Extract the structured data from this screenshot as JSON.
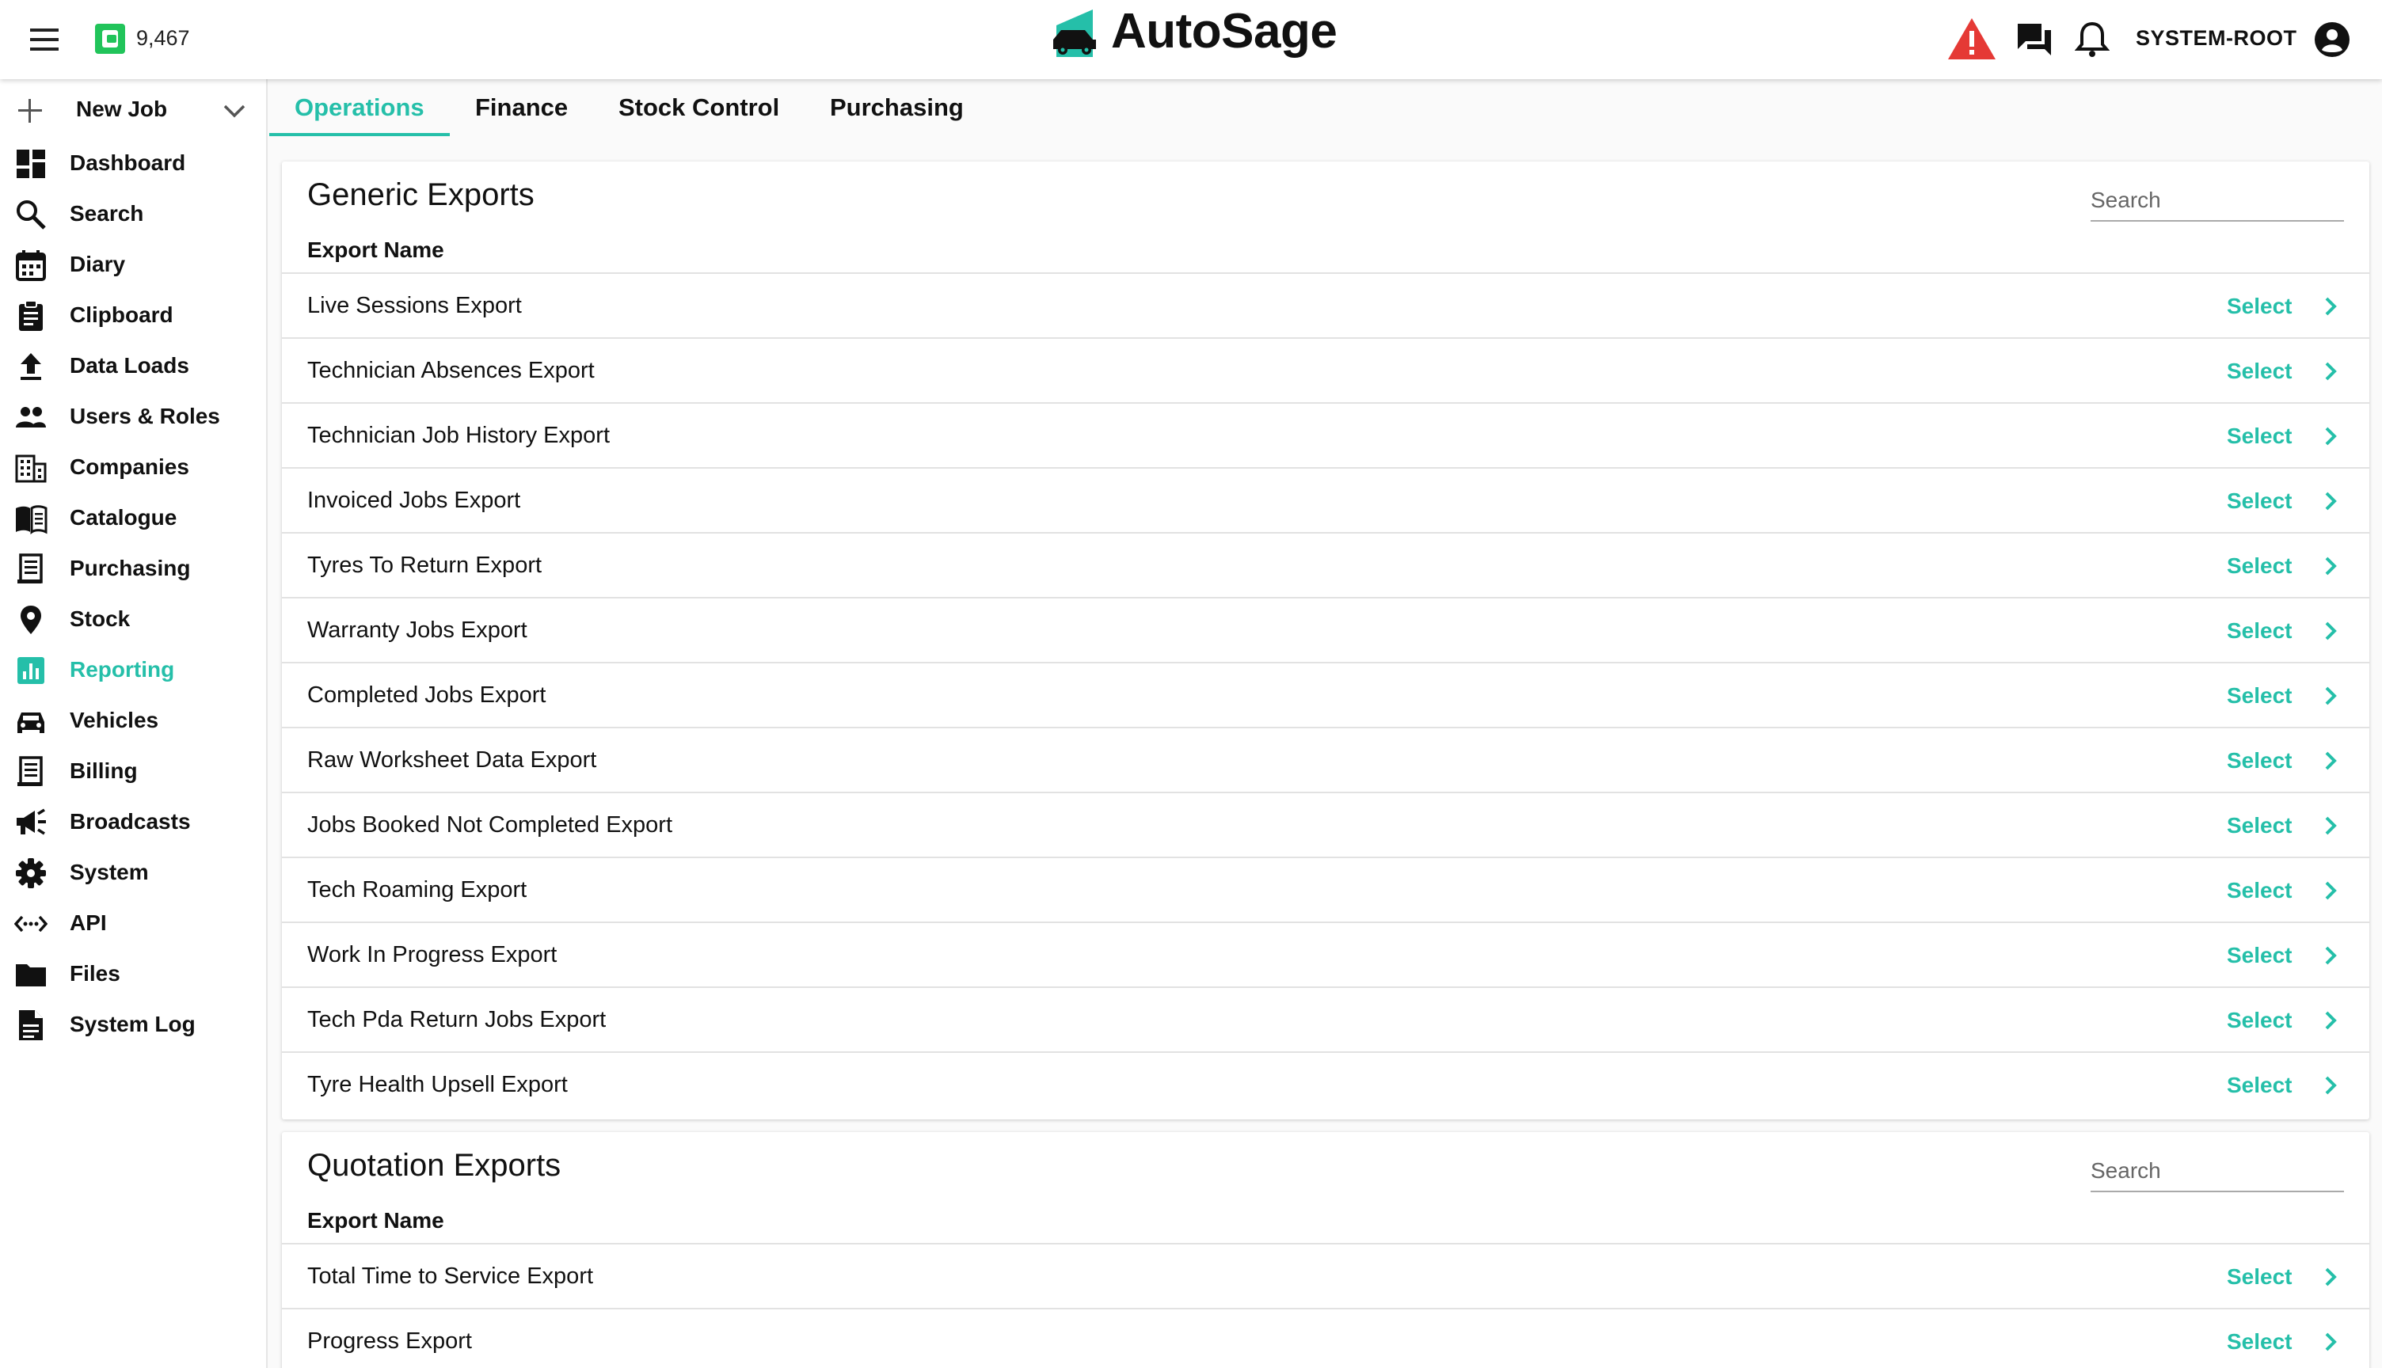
{
  "header": {
    "credit_value": "9,467",
    "brand_name": "AutoSage",
    "username": "SYSTEM-ROOT"
  },
  "sidebar": {
    "new_job_label": "New Job",
    "items": [
      {
        "label": "Dashboard",
        "icon": "dashboard-icon"
      },
      {
        "label": "Search",
        "icon": "search-icon"
      },
      {
        "label": "Diary",
        "icon": "calendar-icon"
      },
      {
        "label": "Clipboard",
        "icon": "clipboard-icon"
      },
      {
        "label": "Data Loads",
        "icon": "upload-icon"
      },
      {
        "label": "Users & Roles",
        "icon": "users-icon"
      },
      {
        "label": "Companies",
        "icon": "building-icon"
      },
      {
        "label": "Catalogue",
        "icon": "book-icon"
      },
      {
        "label": "Purchasing",
        "icon": "receipt-icon"
      },
      {
        "label": "Stock",
        "icon": "location-pin-icon"
      },
      {
        "label": "Reporting",
        "icon": "chart-icon",
        "active": true
      },
      {
        "label": "Vehicles",
        "icon": "car-icon"
      },
      {
        "label": "Billing",
        "icon": "receipt-icon"
      },
      {
        "label": "Broadcasts",
        "icon": "megaphone-icon"
      },
      {
        "label": "System",
        "icon": "gear-icon"
      },
      {
        "label": "API",
        "icon": "code-icon"
      },
      {
        "label": "Files",
        "icon": "folder-icon"
      },
      {
        "label": "System Log",
        "icon": "document-icon"
      }
    ]
  },
  "tabs": [
    {
      "label": "Operations",
      "active": true
    },
    {
      "label": "Finance"
    },
    {
      "label": "Stock Control"
    },
    {
      "label": "Purchasing"
    }
  ],
  "generic_exports": {
    "title": "Generic Exports",
    "search_placeholder": "Search",
    "column_header": "Export Name",
    "rows": [
      {
        "name": "Live Sessions Export",
        "action": "Select"
      },
      {
        "name": "Technician Absences Export",
        "action": "Select"
      },
      {
        "name": "Technician Job History Export",
        "action": "Select"
      },
      {
        "name": "Invoiced Jobs Export",
        "action": "Select"
      },
      {
        "name": "Tyres To Return Export",
        "action": "Select"
      },
      {
        "name": "Warranty Jobs Export",
        "action": "Select"
      },
      {
        "name": "Completed Jobs Export",
        "action": "Select"
      },
      {
        "name": "Raw Worksheet Data Export",
        "action": "Select"
      },
      {
        "name": "Jobs Booked Not Completed Export",
        "action": "Select"
      },
      {
        "name": "Tech Roaming Export",
        "action": "Select"
      },
      {
        "name": "Work In Progress Export",
        "action": "Select"
      },
      {
        "name": "Tech Pda Return Jobs Export",
        "action": "Select"
      },
      {
        "name": "Tyre Health Upsell Export",
        "action": "Select"
      }
    ]
  },
  "quotation_exports": {
    "title": "Quotation Exports",
    "search_placeholder": "Search",
    "column_header": "Export Name",
    "rows": [
      {
        "name": "Total Time to Service Export",
        "action": "Select"
      },
      {
        "name": "Progress Export",
        "action": "Select"
      }
    ]
  },
  "colors": {
    "accent": "#25bfa9",
    "alert": "#e53935",
    "credit": "#21c45a"
  }
}
